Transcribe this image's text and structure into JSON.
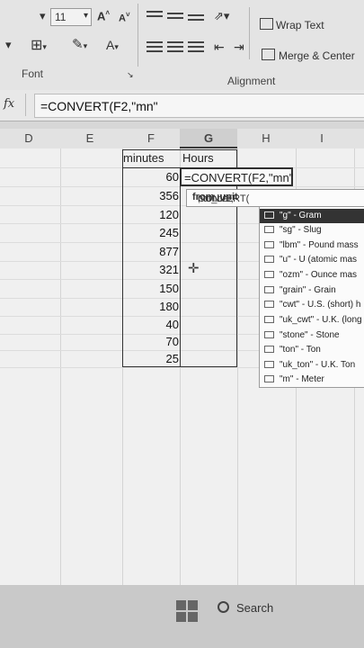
{
  "ribbon": {
    "font_size": "11",
    "grow_font": "A",
    "shrink_font": "A",
    "font_color_label": "A",
    "wrap_text": "Wrap Text",
    "merge_center": "Merge & Center",
    "group_font": "Font",
    "group_alignment": "Alignment"
  },
  "formula_bar": {
    "fx": "fx",
    "value": "=CONVERT(F2,\"mn\""
  },
  "columns": [
    "D",
    "E",
    "F",
    "G",
    "H",
    "I"
  ],
  "headers": {
    "f": "minutes",
    "g": "Hours"
  },
  "minutes": [
    "60",
    "356",
    "120",
    "245",
    "877",
    "321",
    "150",
    "180",
    "40",
    "70",
    "25"
  ],
  "active_cell": "=CONVERT(F2,\"mn\"",
  "tooltip": {
    "fn": "CONVERT(",
    "arg1": "number, ",
    "arg2": "from_unit",
    "arg3": ", to_un"
  },
  "dropdown": [
    "\"g\" - Gram",
    "\"sg\" - Slug",
    "\"lbm\" - Pound mass",
    "\"u\" - U (atomic mas",
    "\"ozm\" - Ounce mas",
    "\"grain\" - Grain",
    "\"cwt\" - U.S. (short) h",
    "\"uk_cwt\" - U.K. (long",
    "\"stone\" - Stone",
    "\"ton\" - Ton",
    "\"uk_ton\" - U.K. Ton",
    "\"m\" - Meter"
  ],
  "taskbar": {
    "search": "Search"
  },
  "colors": {
    "grid_bg": "#f0f0f0",
    "selected_item_bg": "#333333",
    "ribbon_bg": "#e4e4e4"
  }
}
